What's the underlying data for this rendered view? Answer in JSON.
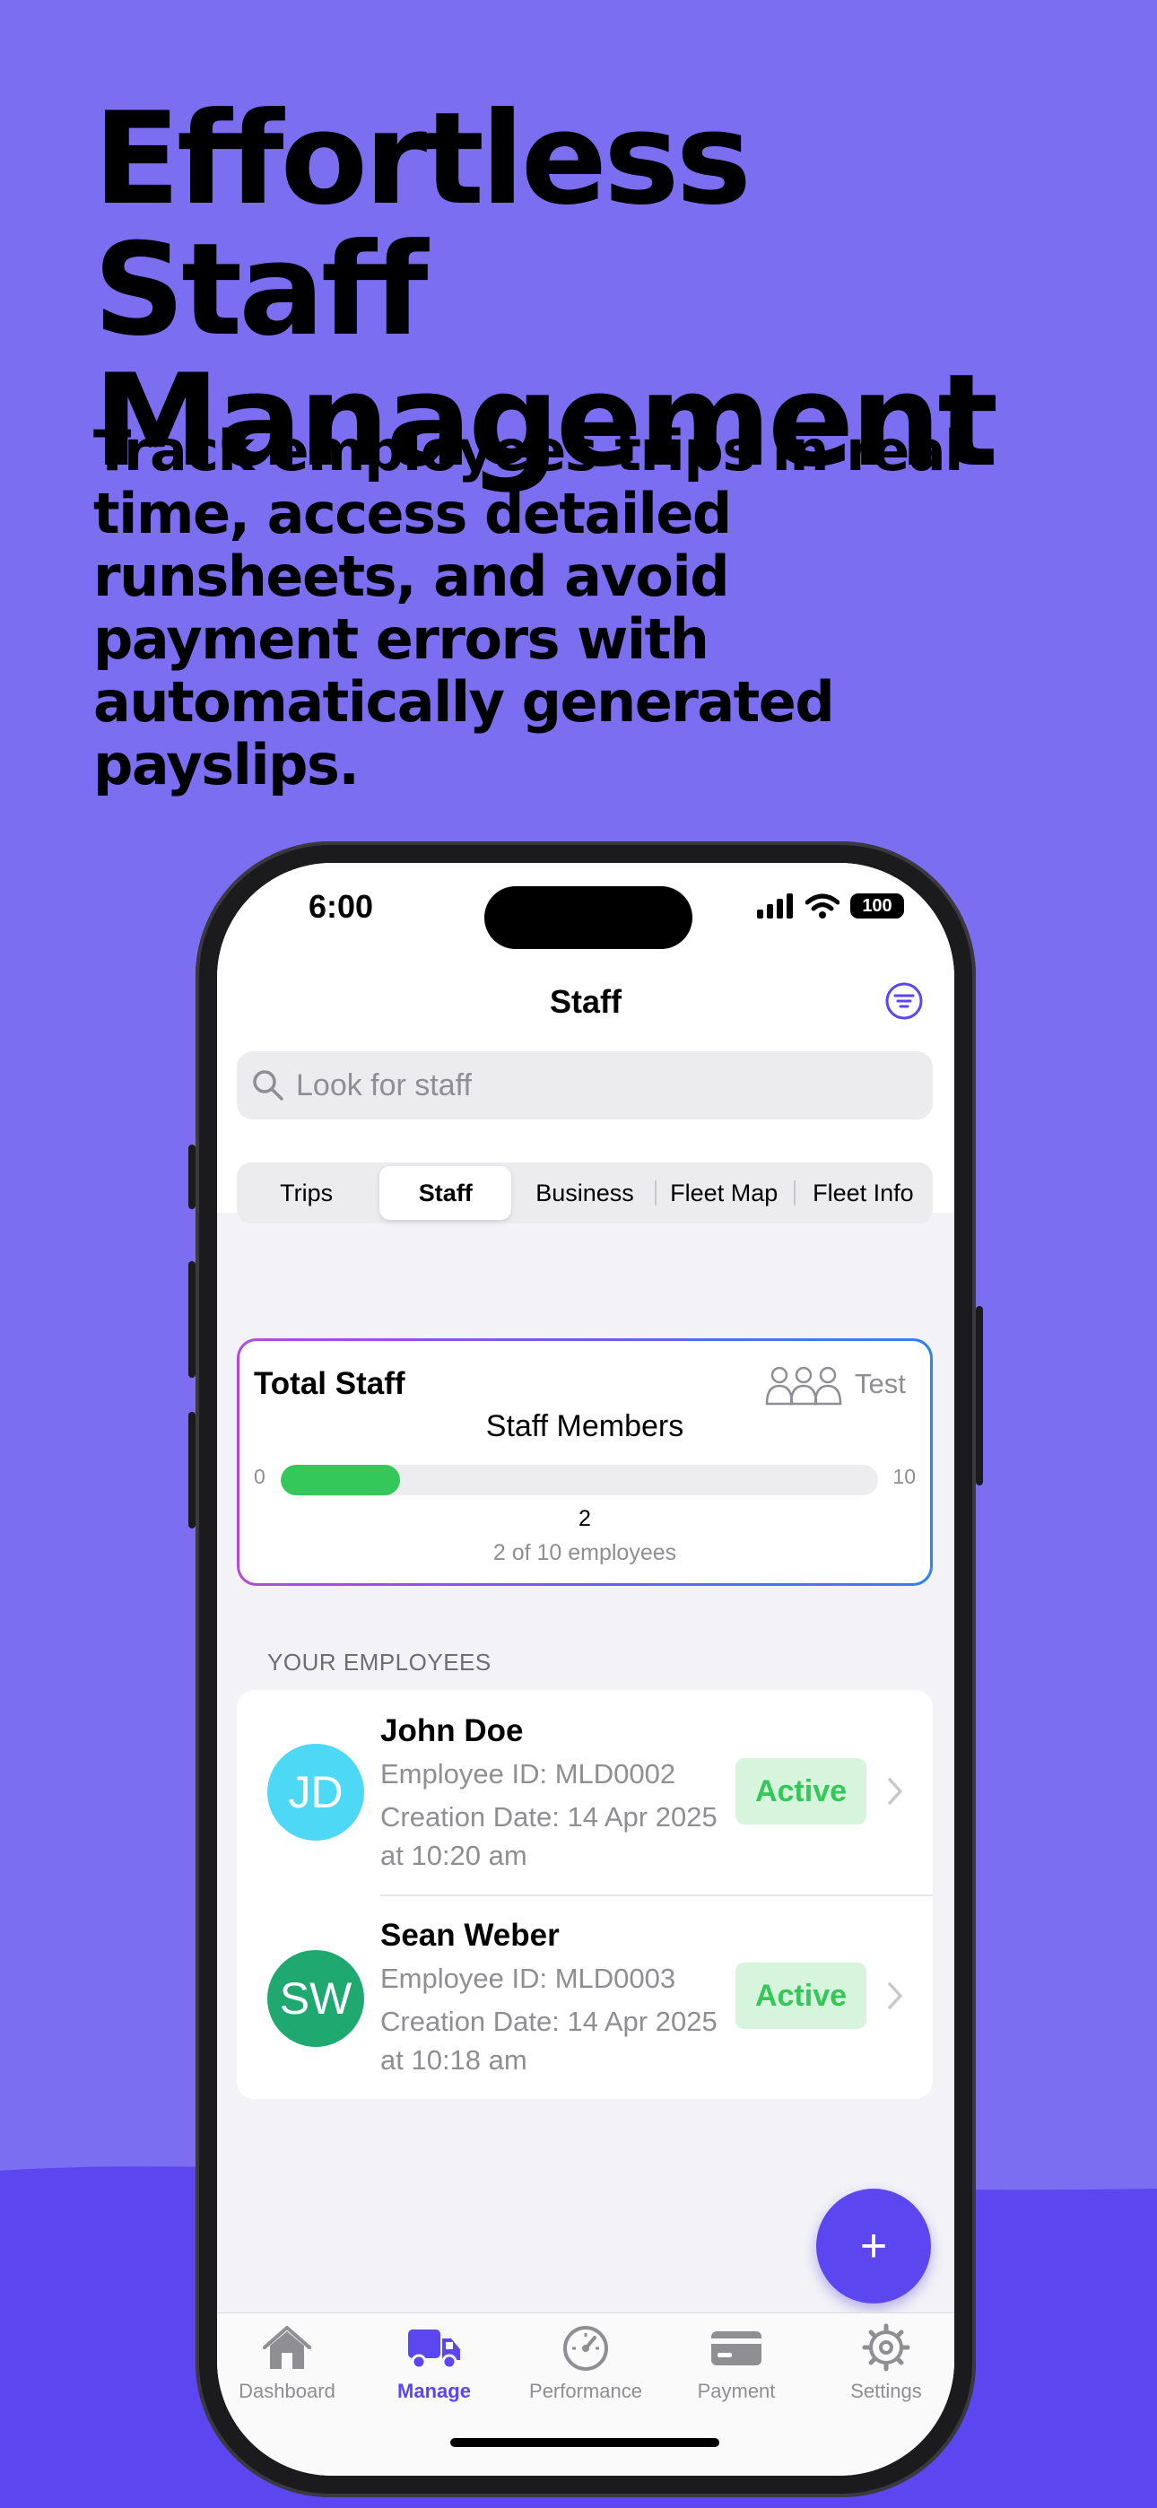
{
  "marketing": {
    "headline": "Effortless Staff Management",
    "subline": "Track employees trips in real-time, access detailed runsheets, and avoid payment errors with automatically generated payslips."
  },
  "status_bar": {
    "time": "6:00",
    "battery": "100"
  },
  "nav": {
    "title": "Staff",
    "filter_icon": "filter-icon"
  },
  "search": {
    "placeholder": "Look for staff"
  },
  "segments": [
    {
      "label": "Trips",
      "selected": false
    },
    {
      "label": "Staff",
      "selected": true
    },
    {
      "label": "Business",
      "selected": false
    },
    {
      "label": "Fleet Map",
      "selected": false
    },
    {
      "label": "Fleet Info",
      "selected": false
    }
  ],
  "summary_card": {
    "title": "Total Staff",
    "tag": "Test",
    "icon": "people-icon",
    "subtitle": "Staff Members",
    "min_label": "0",
    "max_label": "10",
    "count": "2",
    "progress_fraction": 0.2,
    "caption": "2 of 10 employees"
  },
  "employees": {
    "section_label": "YOUR EMPLOYEES",
    "items": [
      {
        "initials": "JD",
        "avatar_color": "#4dd8f5",
        "name": "John Doe",
        "employee_id": "Employee ID: MLD0002",
        "creation": "Creation Date: 14 Apr 2025 at 10:20 am",
        "status": "Active"
      },
      {
        "initials": "SW",
        "avatar_color": "#1fa86f",
        "name": "Sean Weber",
        "employee_id": "Employee ID: MLD0003",
        "creation": "Creation Date: 14 Apr 2025 at 10:18 am",
        "status": "Active"
      }
    ]
  },
  "fab": {
    "label": "+"
  },
  "tab_bar": [
    {
      "label": "Dashboard",
      "icon": "house-icon",
      "active": false
    },
    {
      "label": "Manage",
      "icon": "truck-icon",
      "active": true
    },
    {
      "label": "Performance",
      "icon": "gauge-icon",
      "active": false
    },
    {
      "label": "Payment",
      "icon": "card-icon",
      "active": false
    },
    {
      "label": "Settings",
      "icon": "gear-icon",
      "active": false
    }
  ],
  "colors": {
    "background": "#7b6ef0",
    "accent": "#5b46f0",
    "active_green": "#34c759",
    "active_badge_bg": "#d6f5dc"
  }
}
